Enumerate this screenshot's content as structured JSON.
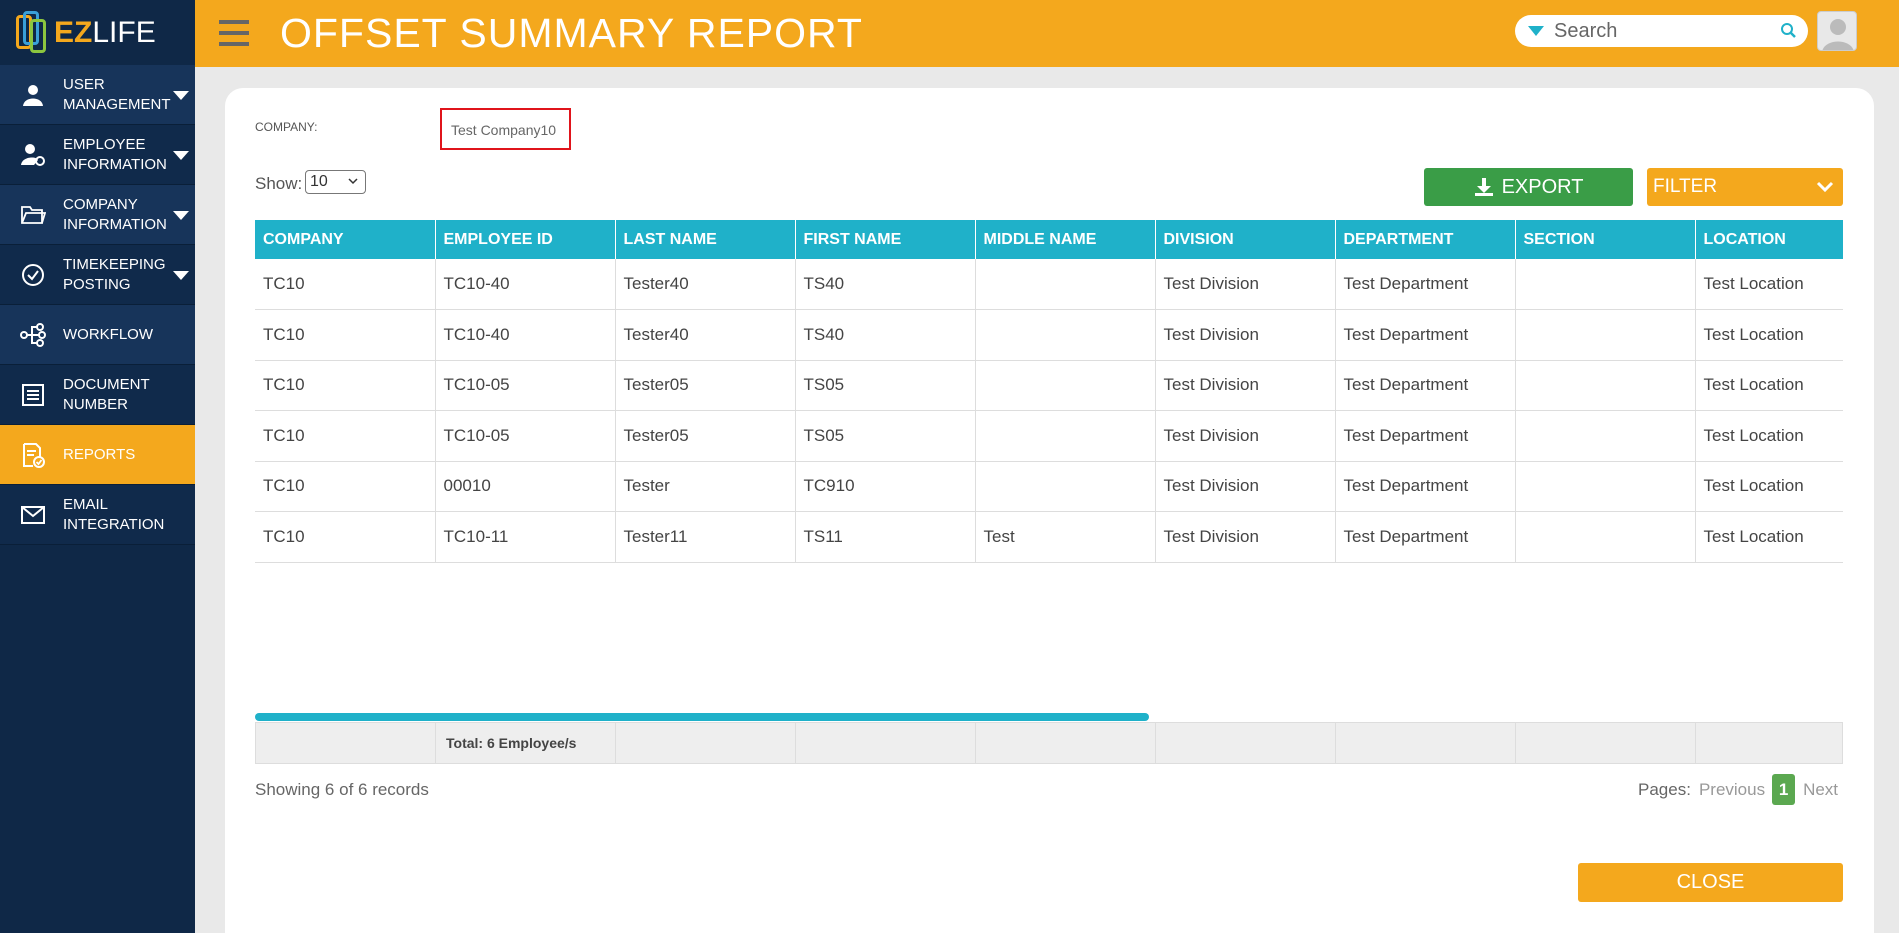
{
  "app": {
    "logo_ez": "EZ",
    "logo_life": "LIFE",
    "page_title": "OFFSET SUMMARY REPORT"
  },
  "colors": {
    "brand_orange": "#f4a81d",
    "sidebar_navy": "#0f2847",
    "table_header_teal": "#1fb1c9",
    "export_green": "#3a9d47",
    "company_highlight_red": "#e0141b"
  },
  "sidebar": {
    "items": [
      {
        "label": "USER MANAGEMENT",
        "icon": "user-icon",
        "has_caret": true
      },
      {
        "label": "EMPLOYEE INFORMATION",
        "icon": "user-gear-icon",
        "has_caret": true
      },
      {
        "label": "COMPANY INFORMATION",
        "icon": "folder-icon",
        "has_caret": true
      },
      {
        "label": "TIMEKEEPING POSTING",
        "icon": "check-circle-icon",
        "has_caret": true
      },
      {
        "label": "WORKFLOW",
        "icon": "workflow-icon",
        "has_caret": false
      },
      {
        "label": "DOCUMENT NUMBER",
        "icon": "document-list-icon",
        "has_caret": false
      },
      {
        "label": "REPORTS",
        "icon": "report-icon",
        "has_caret": false,
        "active": true
      },
      {
        "label": "EMAIL INTEGRATION",
        "icon": "mail-icon",
        "has_caret": false
      }
    ]
  },
  "header": {
    "search_placeholder": "Search"
  },
  "report": {
    "company_label": "COMPANY:",
    "company_value": "Test Company10",
    "show_label": "Show:",
    "show_value": "10",
    "export_label": "EXPORT",
    "filter_label": "FILTER",
    "columns": [
      "COMPANY",
      "EMPLOYEE ID",
      "LAST NAME",
      "FIRST NAME",
      "MIDDLE NAME",
      "DIVISION",
      "DEPARTMENT",
      "SECTION",
      "LOCATION"
    ],
    "rows": [
      [
        "TC10",
        "TC10-40",
        "Tester40",
        "TS40",
        "",
        "Test Division",
        "Test Department",
        "",
        "Test Location"
      ],
      [
        "TC10",
        "TC10-40",
        "Tester40",
        "TS40",
        "",
        "Test Division",
        "Test Department",
        "",
        "Test Location"
      ],
      [
        "TC10",
        "TC10-05",
        "Tester05",
        "TS05",
        "",
        "Test Division",
        "Test Department",
        "",
        "Test Location"
      ],
      [
        "TC10",
        "TC10-05",
        "Tester05",
        "TS05",
        "",
        "Test Division",
        "Test Department",
        "",
        "Test Location"
      ],
      [
        "TC10",
        "00010",
        "Tester",
        "TC910",
        "",
        "Test Division",
        "Test Department",
        "",
        "Test Location"
      ],
      [
        "TC10",
        "TC10-11",
        "Tester11",
        "TS11",
        "Test",
        "Test Division",
        "Test Department",
        "",
        "Test Location"
      ]
    ],
    "total_text": "Total: 6 Employee/s",
    "records_text": "Showing 6 of 6 records",
    "pages_label": "Pages:",
    "prev_label": "Previous",
    "current_page": "1",
    "next_label": "Next",
    "close_label": "CLOSE"
  }
}
